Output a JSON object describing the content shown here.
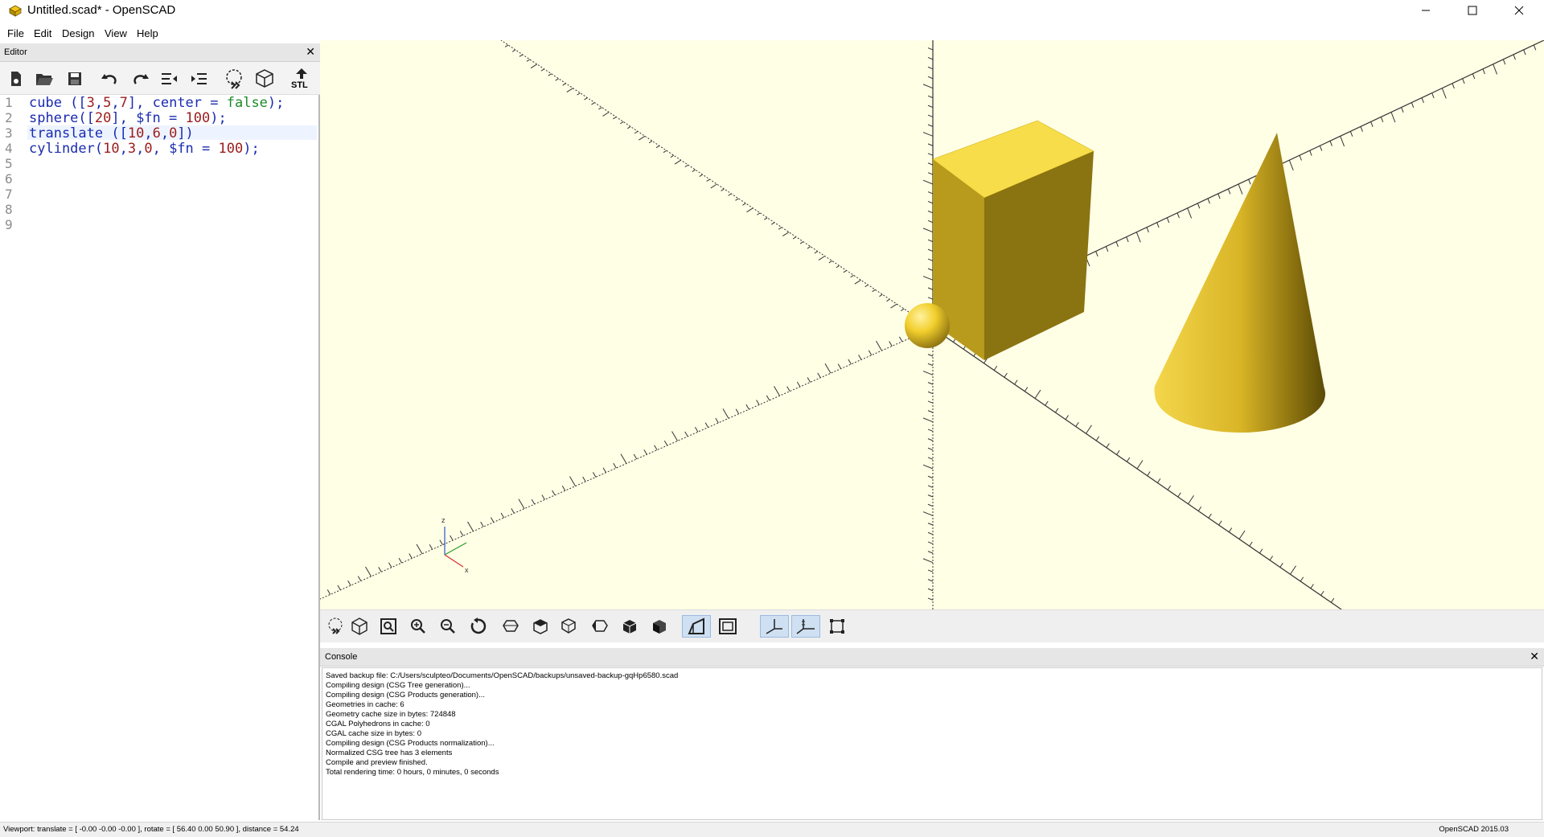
{
  "window": {
    "title": "Untitled.scad* - OpenSCAD",
    "minimize_icon": "minimize-icon",
    "maximize_icon": "maximize-icon",
    "close_icon": "close-icon"
  },
  "menu": [
    "File",
    "Edit",
    "Design",
    "View",
    "Help"
  ],
  "editor": {
    "panel_title": "Editor",
    "line_numbers": [
      "1",
      "2",
      "3",
      "4",
      "5",
      "6",
      "7",
      "8",
      "9"
    ],
    "toolbar_icons": [
      "new-file-icon",
      "open-file-icon",
      "save-icon",
      "undo-icon",
      "redo-icon",
      "unindent-icon",
      "indent-icon",
      "preview-icon",
      "render-icon",
      "export-stl-icon"
    ],
    "export_label": "STL"
  },
  "viewport": {
    "axis_labels": {
      "z": "z",
      "x": "x"
    },
    "toolbar_icons": [
      "preview-icon",
      "render-icon",
      "view-all-icon",
      "zoom-in-icon",
      "zoom-out-icon",
      "reset-view-icon",
      "view-right-icon",
      "view-top-icon",
      "view-bottom-icon",
      "view-left-icon",
      "view-front-icon",
      "view-back-icon",
      "perspective-icon",
      "orthogonal-icon",
      "show-axes-icon",
      "show-scale-markers-icon",
      "show-edges-icon"
    ],
    "background_color": "#ffffe6",
    "object_color": "#f3d43a"
  },
  "console": {
    "title": "Console",
    "lines": [
      "Saved backup file: C:/Users/sculpteo/Documents/OpenSCAD/backups/unsaved-backup-gqHp6580.scad",
      "Compiling design (CSG Tree generation)...",
      "Compiling design (CSG Products generation)...",
      "Geometries in cache: 6",
      "Geometry cache size in bytes: 724848",
      "CGAL Polyhedrons in cache: 0",
      "CGAL cache size in bytes: 0",
      "Compiling design (CSG Products normalization)...",
      "Normalized CSG tree has 3 elements",
      "Compile and preview finished.",
      "Total rendering time: 0 hours, 0 minutes, 0 seconds"
    ]
  },
  "statusbar": {
    "viewport_info": "Viewport: translate = [ -0.00 -0.00 -0.00 ], rotate = [ 56.40 0.00 50.90 ], distance = 54.24",
    "version": "OpenSCAD 2015.03"
  }
}
